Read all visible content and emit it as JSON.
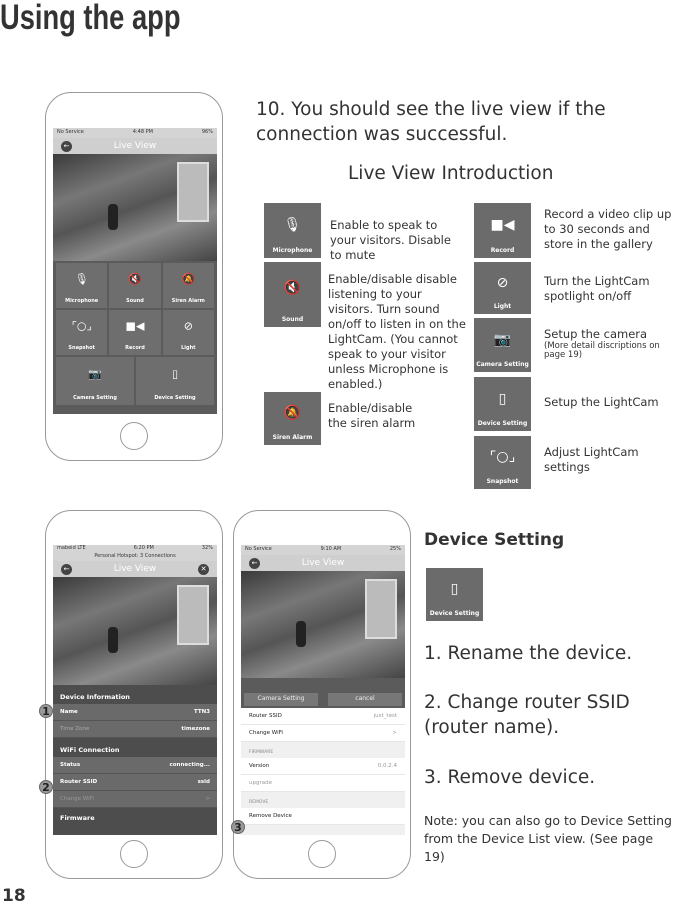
{
  "title": "Using the app",
  "page_number": "18",
  "step10": "10. You should see the live view if the connection was successful.",
  "intro_heading": "Live View Introduction",
  "phone1": {
    "carrier": "No Service",
    "time": "4:48 PM",
    "battery": "96%",
    "nav_title": "Live View",
    "tiles": [
      "Microphone",
      "Sound",
      "Siren Alarm",
      "Snapshot",
      "Record",
      "Light",
      "Camera Setting",
      "Device Setting"
    ]
  },
  "features_left": [
    {
      "label": "Microphone",
      "icon": "microphone-off-icon",
      "text": "Enable to speak to your visitors. Disable to mute"
    },
    {
      "label": "Sound",
      "icon": "speaker-mute-icon",
      "text": "Enable/disable disable listening to your visitors. Turn sound on/off to listen in on the LightCam. (You cannot speak to your visitor unless Microphone is enabled.)"
    },
    {
      "label": "Siren Alarm",
      "icon": "bell-off-icon",
      "text": "Enable/disable the siren alarm"
    }
  ],
  "features_right": [
    {
      "label": "Record",
      "icon": "video-camera-icon",
      "text": "Record a video clip up to 30 seconds and store in the gallery"
    },
    {
      "label": "Light",
      "icon": "light-off-icon",
      "text": "Turn the LightCam spotlight on/off"
    },
    {
      "label": "Camera Setting",
      "icon": "camera-icon",
      "text": "Setup the camera",
      "note": "(More detail discriptions on page 19)"
    },
    {
      "label": "Device Setting",
      "icon": "device-icon",
      "text": "Setup the LightCam"
    },
    {
      "label": "Snapshot",
      "icon": "snapshot-icon",
      "text": "Adjust LightCam settings"
    }
  ],
  "phone2": {
    "carrier": "mabeid  LTE",
    "time": "6:20 PM",
    "battery": "32%",
    "hotspot": "Personal Hotspot: 3 Connections",
    "nav_title": "Live View",
    "device_info": "Device Information",
    "name_label": "Name",
    "name_value": "TTN3",
    "tz_label": "Time Zone",
    "tz_value": "timezone",
    "wifi": "WiFi Connection",
    "status_label": "Status",
    "status_value": "connecting...",
    "ssid_label": "Router SSID",
    "ssid_value": "ssid",
    "change_wifi": "Change WiFi",
    "chevron": ">",
    "firmware": "Firmware"
  },
  "phone3": {
    "carrier": "No Service",
    "time": "9:10 AM",
    "battery": "25%",
    "nav_title": "Live View",
    "camera_setting": "Camera Setting",
    "cancel": "cancel",
    "ssid_label": "Router SSID",
    "ssid_value": "just_test",
    "change_wifi": "Change WiFi",
    "chevron": ">",
    "firmware": "FIRMWARE",
    "version_label": "Version",
    "version_value": "0.0.2.4",
    "upgrade": "upgrade",
    "remove": "REMOVE",
    "remove_device": "Remove Device"
  },
  "badges": [
    "1",
    "2",
    "3"
  ],
  "device_setting": {
    "heading": "Device Setting",
    "tile_label": "Device Setting",
    "steps": [
      "1. Rename the device.",
      "2. Change router SSID (router name).",
      "3. Remove device."
    ],
    "note": "Note: you can also go to Device Setting from the Device List view. (See page 19)"
  }
}
